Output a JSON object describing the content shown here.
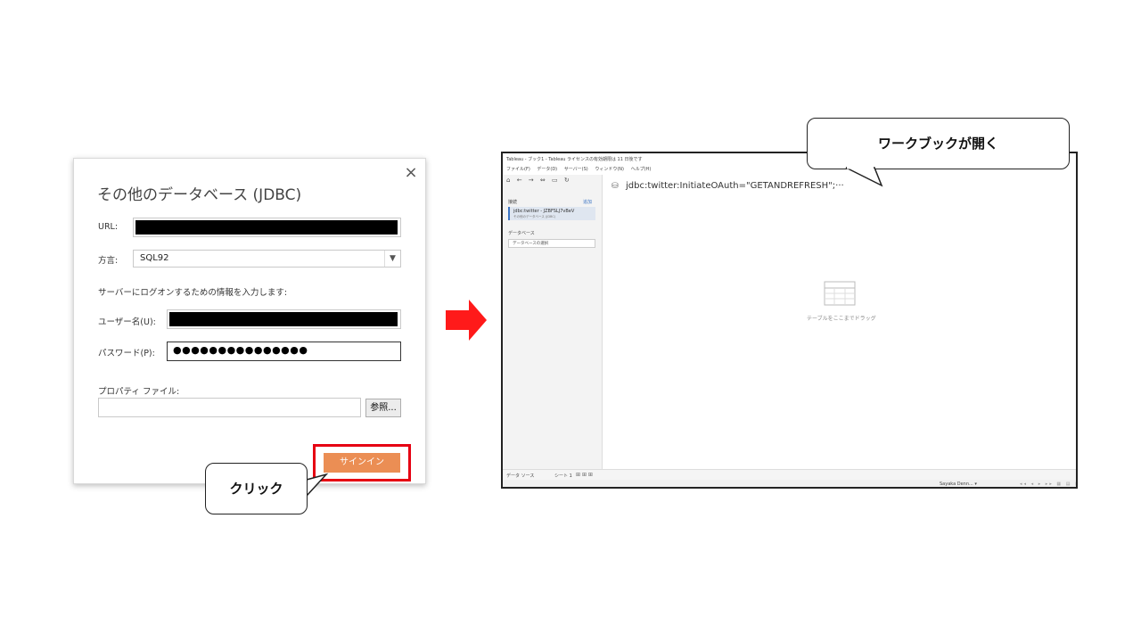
{
  "dialog": {
    "title": "その他のデータベース (JDBC)",
    "close": "×",
    "url_label": "URL:",
    "url_value": "",
    "dialect_label": "方言:",
    "dialect_value": "SQL92",
    "dialect_arrow": "▼",
    "signin_instruction": "サーバーにログオンするための情報を入力します:",
    "username_label": "ユーザー名(U):",
    "username_value": "",
    "password_label": "パスワード(P):",
    "password_value": "●●●●●●●●●●●●●●●",
    "properties_label": "プロパティ ファイル:",
    "properties_value": "",
    "browse_button": "参照...",
    "signin_button": "サインイン"
  },
  "callouts": {
    "click": "クリック",
    "workbook_opens": "ワークブックが開く"
  },
  "colors": {
    "highlight_red": "#e60012",
    "arrow_red": "#ff1a1a",
    "signin_orange": "#eb8e54"
  },
  "tableau": {
    "title": "Tableau - ブック1 - Tableau ライセンスの有効期限は 11 日後です",
    "menu": [
      "ファイル(F)",
      "データ(D)",
      "サーバー(S)",
      "ウィンドウ(N)",
      "ヘルプ(H)"
    ],
    "toolbar_icons": [
      "home-icon",
      "back-icon",
      "forward-icon",
      "link-icon",
      "save-icon",
      "refresh-icon"
    ],
    "connections_header": "接続",
    "connections_add": "追加",
    "connection_name": "jdbc:twitter - JZBFSLJ7vBeV",
    "connection_sub": "その他のデータベース (JDBC)",
    "database_label": "データベース",
    "database_select": "データベースの選択",
    "connection_label": "jdbc:twitter:InitiateOAuth=\"GETANDREFRESH\";···",
    "drag_hint": "テーブルをここまでドラッグ",
    "tab_datasource": "データ ソース",
    "tab_sheet": "シート 1",
    "status_user": "Sayaka Denn...",
    "status_arrow": "▾"
  }
}
